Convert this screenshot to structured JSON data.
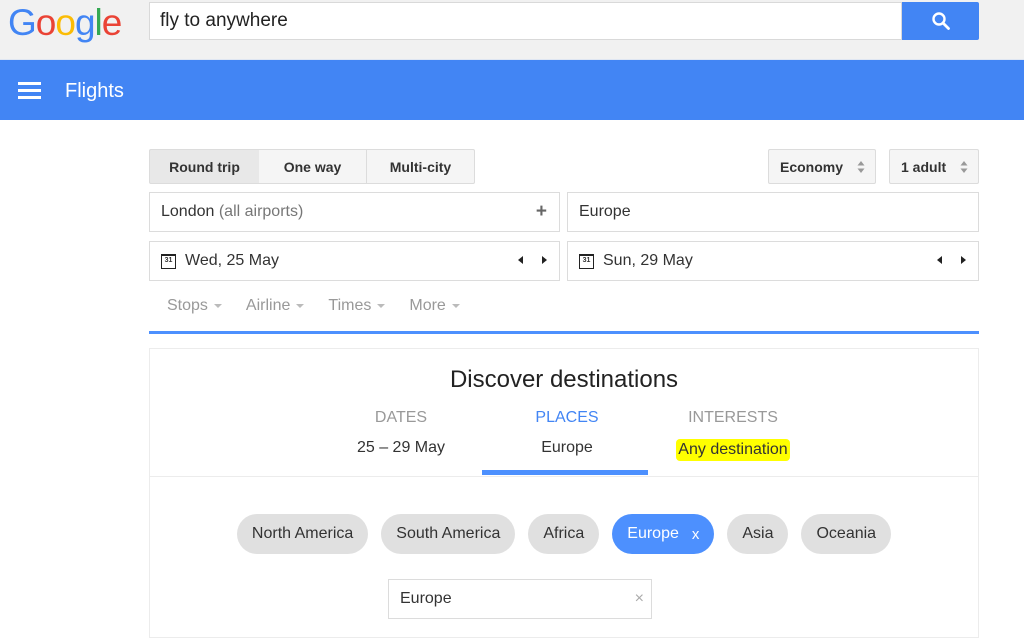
{
  "google_logo": {
    "letters": [
      {
        "char": "G",
        "color": "#4285f4"
      },
      {
        "char": "o",
        "color": "#ea4335"
      },
      {
        "char": "o",
        "color": "#fbbc05"
      },
      {
        "char": "g",
        "color": "#4285f4"
      },
      {
        "char": "l",
        "color": "#34a853"
      },
      {
        "char": "e",
        "color": "#ea4335"
      }
    ]
  },
  "search": {
    "value": "fly to anywhere",
    "button_icon": "search-icon"
  },
  "header": {
    "menu_icon": "hamburger-menu-icon",
    "title": "Flights"
  },
  "trip_types": [
    {
      "label": "Round trip",
      "active": true
    },
    {
      "label": "One way",
      "active": false
    },
    {
      "label": "Multi-city",
      "active": false
    }
  ],
  "cabin_class": {
    "selected": "Economy"
  },
  "passengers": {
    "selected": "1 adult"
  },
  "origin": {
    "city": "London",
    "qualifier": "(all airports)",
    "add_icon": "+"
  },
  "destination": {
    "value": "Europe"
  },
  "depart_date": {
    "value": "Wed, 25 May",
    "calendar_icon_text": "31"
  },
  "return_date": {
    "value": "Sun, 29 May",
    "calendar_icon_text": "31"
  },
  "filters": [
    {
      "label": "Stops"
    },
    {
      "label": "Airline"
    },
    {
      "label": "Times"
    },
    {
      "label": "More"
    }
  ],
  "discover": {
    "title": "Discover destinations",
    "tabs": [
      {
        "label": "DATES",
        "value": "25 – 29 May",
        "active": false,
        "highlighted": false
      },
      {
        "label": "PLACES",
        "value": "Europe",
        "active": true,
        "highlighted": false
      },
      {
        "label": "INTERESTS",
        "value": "Any destination",
        "active": false,
        "highlighted": true
      }
    ],
    "regions": [
      {
        "label": "North America",
        "selected": false
      },
      {
        "label": "South America",
        "selected": false
      },
      {
        "label": "Africa",
        "selected": false
      },
      {
        "label": "Europe",
        "selected": true,
        "remove_label": "x"
      },
      {
        "label": "Asia",
        "selected": false
      },
      {
        "label": "Oceania",
        "selected": false
      }
    ],
    "region_input": {
      "value": "Europe",
      "clear_label": "×"
    }
  },
  "colors": {
    "accent": "#4285f4",
    "highlight": "#ffff00"
  }
}
